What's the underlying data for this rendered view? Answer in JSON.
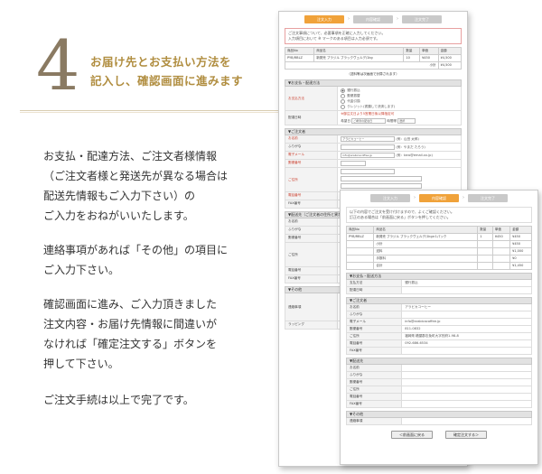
{
  "step": {
    "number": "4",
    "title_line1": "お届け先とお支払い方法を",
    "title_line2": "記入し、確認画面に進みます"
  },
  "paragraphs": [
    "お支払・配達方法、ご注文者様情報\n（ご注文者様と発送先が異なる場合は\n配送先情報もご入力下さい）の\nご入力をおねがいいたします。",
    "連絡事項があれば「その他」の項目に\nご入力下さい。",
    "確認画面に進み、ご入力頂きました\n注文内容・お届け先情報に間違いが\nなければ「確定注文する」ボタンを\n押して下さい。",
    "ご注文手続は以上で完了です。"
  ],
  "form_shot": {
    "steps": [
      "注文入力",
      "内容確認",
      "注文完了"
    ],
    "notice": "ご注文事項について、必要事項を正確に入力してください。\n入力項目において ※ マークのある項目は入力必須です。",
    "items_header": [
      "商品No",
      "商品名",
      "数量",
      "単価",
      "金額"
    ],
    "items_row": [
      "PYB/RBLZ",
      "新発売 ブラジル ブラックヴェルデ/1kg",
      "10",
      "¥450",
      "¥4,500"
    ],
    "subtotal_label": "小計",
    "subtotal_value": "¥4,500",
    "tax_note": "（送料等は次画面で計算されます）",
    "payment_section": "▼お支払・配達方法",
    "payment_label": "お支払方法",
    "payment_options": [
      "銀行振込",
      "郵便振替",
      "代金引換",
      "クレジット(書類して決済します)"
    ],
    "delivery_label": "配達日時",
    "delivery_note": "※御注文日より5営業日後以降指定可",
    "delivery_date_label": "希望日",
    "delivery_date_value": "ご希望の配達日",
    "delivery_time_label": "時間帯",
    "delivery_time_value": "選択",
    "orderer_section": "▼ご注文者",
    "orderer_rows": [
      {
        "label": "お名前",
        "value": "アラビカコーヒー",
        "hint": "(例：山田 太郎)"
      },
      {
        "label": "ふりがな",
        "value": "",
        "hint": "(例：やまだ たろう)"
      },
      {
        "label": "電子メール",
        "value": "info@arabicacoffee.jp",
        "hint": "(例：taro@email.xx.jp)"
      },
      {
        "label": "郵便番号",
        "value": "",
        "hint": ""
      },
      {
        "label": "ご住所",
        "value": "",
        "hint": ""
      },
      {
        "label": "電話番号",
        "value": "",
        "hint": ""
      },
      {
        "label": "FAX番号",
        "value": "",
        "hint": ""
      }
    ],
    "shipping_section": "▼配送先（ご注文者の住所と異なる場合）",
    "shipping_rows": [
      "お名前",
      "ふりがな",
      "郵便番号",
      "ご住所",
      "電話番号",
      "FAX番号"
    ],
    "other_section": "▼その他",
    "other_rows": [
      "連絡事項",
      "ラッピング"
    ]
  },
  "confirm_shot": {
    "steps": [
      "注文入力",
      "内容確認",
      "注文完了"
    ],
    "notice": "以下の内容でご注文を受け付けますので、よくご確認ください。\n訂正のある場合は「前画面に戻る」ボタンを押してください。",
    "items_header": [
      "商品No",
      "商品名",
      "数量",
      "単価",
      "金額"
    ],
    "items_rows": [
      [
        "PYB/RBLZ",
        "新発売 ブラジル ブラックヴェルデ/1kg×1パック",
        "1",
        "¥450",
        "¥450"
      ],
      [
        "",
        "小計",
        "",
        "",
        "¥450"
      ],
      [
        "",
        "送料",
        "",
        "",
        "¥1,000"
      ],
      [
        "",
        "手数料",
        "",
        "",
        "¥0"
      ],
      [
        "",
        "合計",
        "",
        "",
        "¥1,450"
      ]
    ],
    "payment_section": "▼お支払・配送方法",
    "payment_rows": [
      {
        "label": "支払方法",
        "value": "銀行振込"
      },
      {
        "label": "配達日時",
        "value": ""
      }
    ],
    "orderer_section": "▼ご注文者",
    "orderer_rows": [
      {
        "label": "お名前",
        "value": "アラビカコーヒー"
      },
      {
        "label": "ふりがな",
        "value": ""
      },
      {
        "label": "電子メール",
        "value": "info@arabicacoffee.jp"
      },
      {
        "label": "郵便番号",
        "value": "811-0832"
      },
      {
        "label": "ご住所",
        "value": "福岡県 糟屋郡志免町大字別府1-98-8"
      },
      {
        "label": "電話番号",
        "value": "092-686-6534"
      },
      {
        "label": "FAX番号",
        "value": ""
      }
    ],
    "shipping_section": "▼配送先",
    "shipping_rows": [
      "お名前",
      "ふりがな",
      "郵便番号",
      "ご住所",
      "電話番号",
      "FAX番号"
    ],
    "other_section": "▼その他",
    "other_rows": [
      "連絡事項"
    ],
    "back_button": "＜前画面に戻る",
    "confirm_button": "確定注文する＞"
  }
}
